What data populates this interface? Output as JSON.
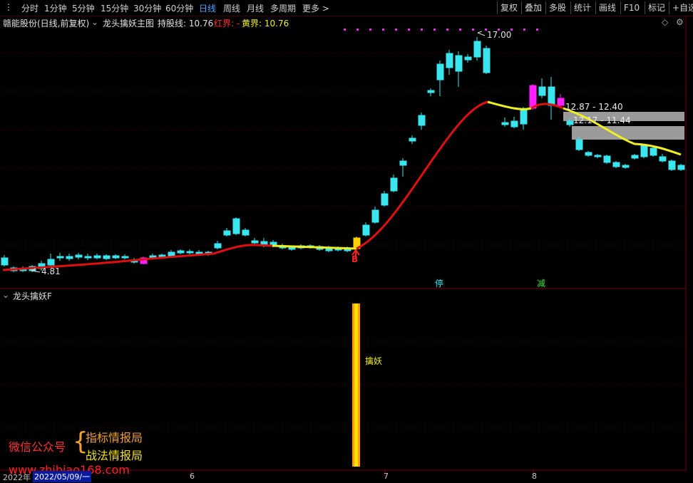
{
  "toolbar": {
    "periods": [
      "分时",
      "1分钟",
      "5分钟",
      "15分钟",
      "30分钟",
      "60分钟",
      "日线",
      "周线",
      "月线",
      "多周期",
      "更多 >"
    ],
    "active_period": "日线",
    "right_buttons": [
      "复权",
      "叠加",
      "多股",
      "统计",
      "画线",
      "F10",
      "标记",
      "+自选"
    ]
  },
  "header": {
    "stock": "赣能股份(日线,前复权)",
    "indicator": "龙头擒妖主图",
    "hold_line_label": "持股线: 10.76",
    "red_label": "红界: -",
    "yellow_label": "黄界: 10.76"
  },
  "main_chart": {
    "price_high_label": "17.00",
    "price_low_label": "4.81",
    "zone1_label": "12.87 - 12.40",
    "zone2_label": "12.17 - 11.44",
    "buy_marker": "B",
    "tag_limit": "停",
    "tag_reduce": "减",
    "colors": {
      "up": "#ff4a4a",
      "down": "#39e6f0",
      "red_line": "#e01010",
      "yellow_line": "#f0f020",
      "magenta": "#ff20ff"
    }
  },
  "sub_chart": {
    "title": "龙头擒妖F",
    "signal_label": "擒妖"
  },
  "watermark": {
    "line1": "微信公众号",
    "brace": "{",
    "line2": "指标情报局",
    "line3": "战法情报局",
    "url": "www.zhibiao168.com"
  },
  "axis": {
    "date_box": "2022/05/09/一",
    "year_label": "2022年",
    "months": [
      "6",
      "7",
      "8"
    ]
  }
}
